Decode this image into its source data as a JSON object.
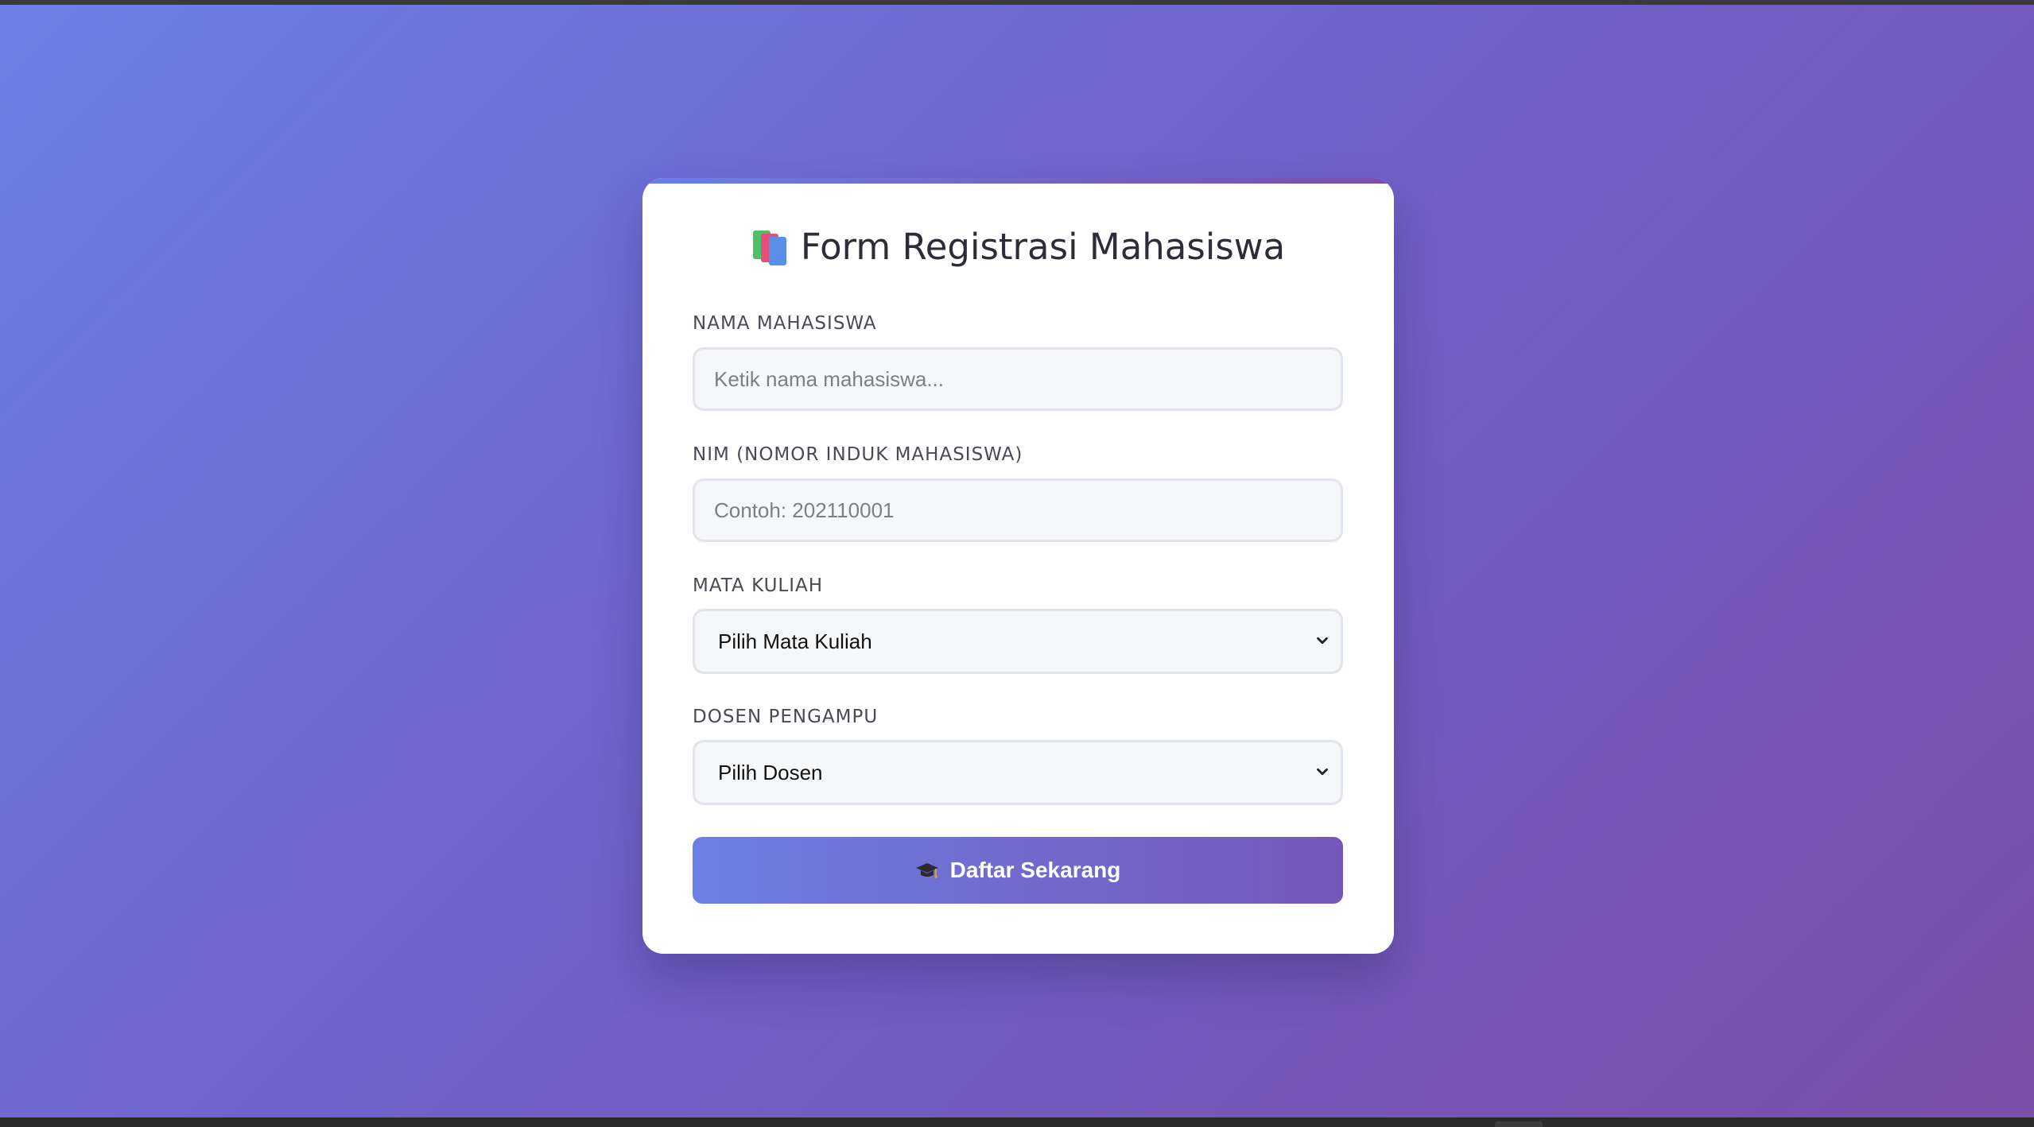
{
  "form": {
    "title": "Form Registrasi Mahasiswa",
    "title_icon": "books-icon",
    "fields": {
      "nama": {
        "label": "Nama Mahasiswa",
        "placeholder": "Ketik nama mahasiswa...",
        "value": ""
      },
      "nim": {
        "label": "NIM (Nomor Induk Mahasiswa)",
        "placeholder": "Contoh: 202110001",
        "value": ""
      },
      "mata_kuliah": {
        "label": "Mata Kuliah",
        "selected": "Pilih Mata Kuliah"
      },
      "dosen": {
        "label": "Dosen Pengampu",
        "selected": "Pilih Dosen"
      }
    },
    "submit": {
      "label": "Daftar Sekarang",
      "icon": "graduation-cap-icon"
    }
  },
  "colors": {
    "gradient_start": "#6b7fe6",
    "gradient_end": "#7a4ea9",
    "card_background": "#ffffff",
    "input_background": "#f6f7f9",
    "input_border": "#e1e4ea"
  }
}
